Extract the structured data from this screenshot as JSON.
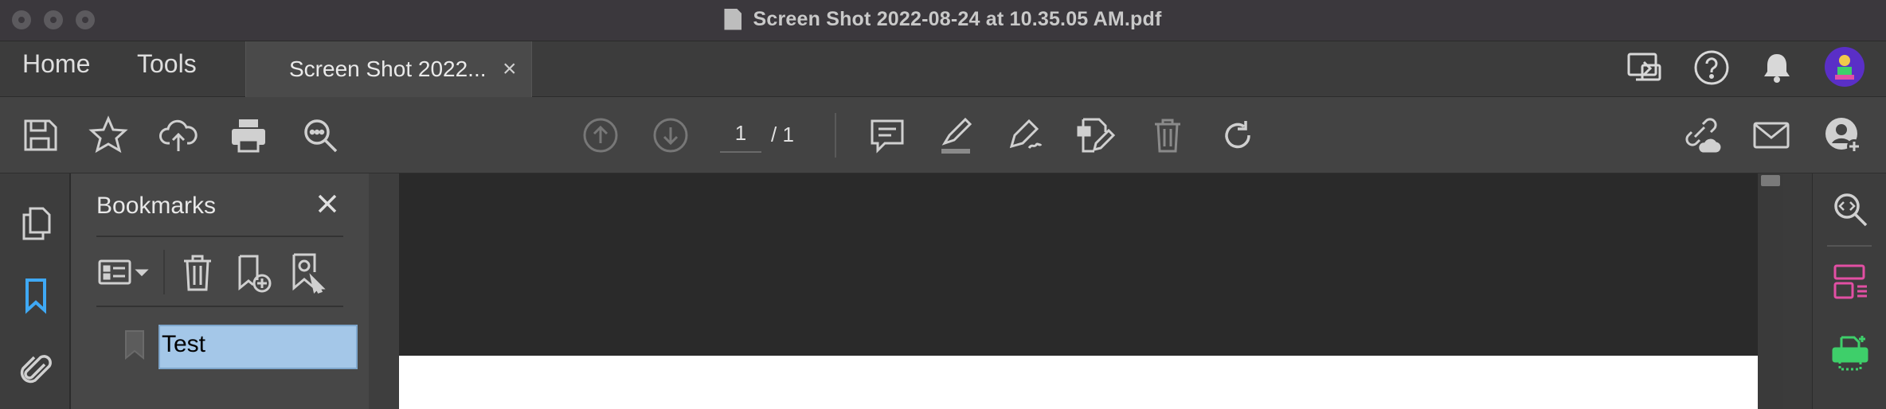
{
  "window": {
    "title": "Screen Shot 2022-08-24 at 10.35.05 AM.pdf"
  },
  "tabs": {
    "home": "Home",
    "tools": "Tools",
    "document_tab": "Screen Shot 2022...",
    "close_symbol": "×"
  },
  "toolbar": {
    "current_page": "1",
    "page_total": "/ 1"
  },
  "bookmarks_panel": {
    "title": "Bookmarks",
    "items": [
      {
        "label": "Test",
        "selected": true
      }
    ]
  },
  "colors": {
    "accent_blue": "#3fa9f5",
    "organize_pink": "#e24fa4",
    "print_green": "#3ecf6a",
    "selection_blue": "#a4c7e8"
  },
  "icons": {
    "titlebar": [
      "document-icon"
    ],
    "top_right": [
      "share-screen-icon",
      "help-icon",
      "bell-icon",
      "avatar"
    ],
    "toolbar": [
      "save-icon",
      "star-icon",
      "cloud-upload-icon",
      "print-icon",
      "search-zoom-icon",
      "arrow-up-circle-icon",
      "arrow-down-circle-icon",
      "comment-icon",
      "highlighter-icon",
      "pen-sign-icon",
      "edit-document-icon",
      "trash-icon",
      "rotate-icon",
      "link-cloud-icon",
      "envelope-icon",
      "add-user-icon"
    ],
    "left_rail": [
      "pages-icon",
      "bookmark-icon",
      "paperclip-icon"
    ],
    "bookmark_tools": [
      "options-list-icon",
      "trash-icon",
      "bookmark-add-icon",
      "bookmark-search-icon"
    ],
    "right_rail": [
      "zoom-icon",
      "organize-pages-icon",
      "print-production-icon"
    ]
  }
}
